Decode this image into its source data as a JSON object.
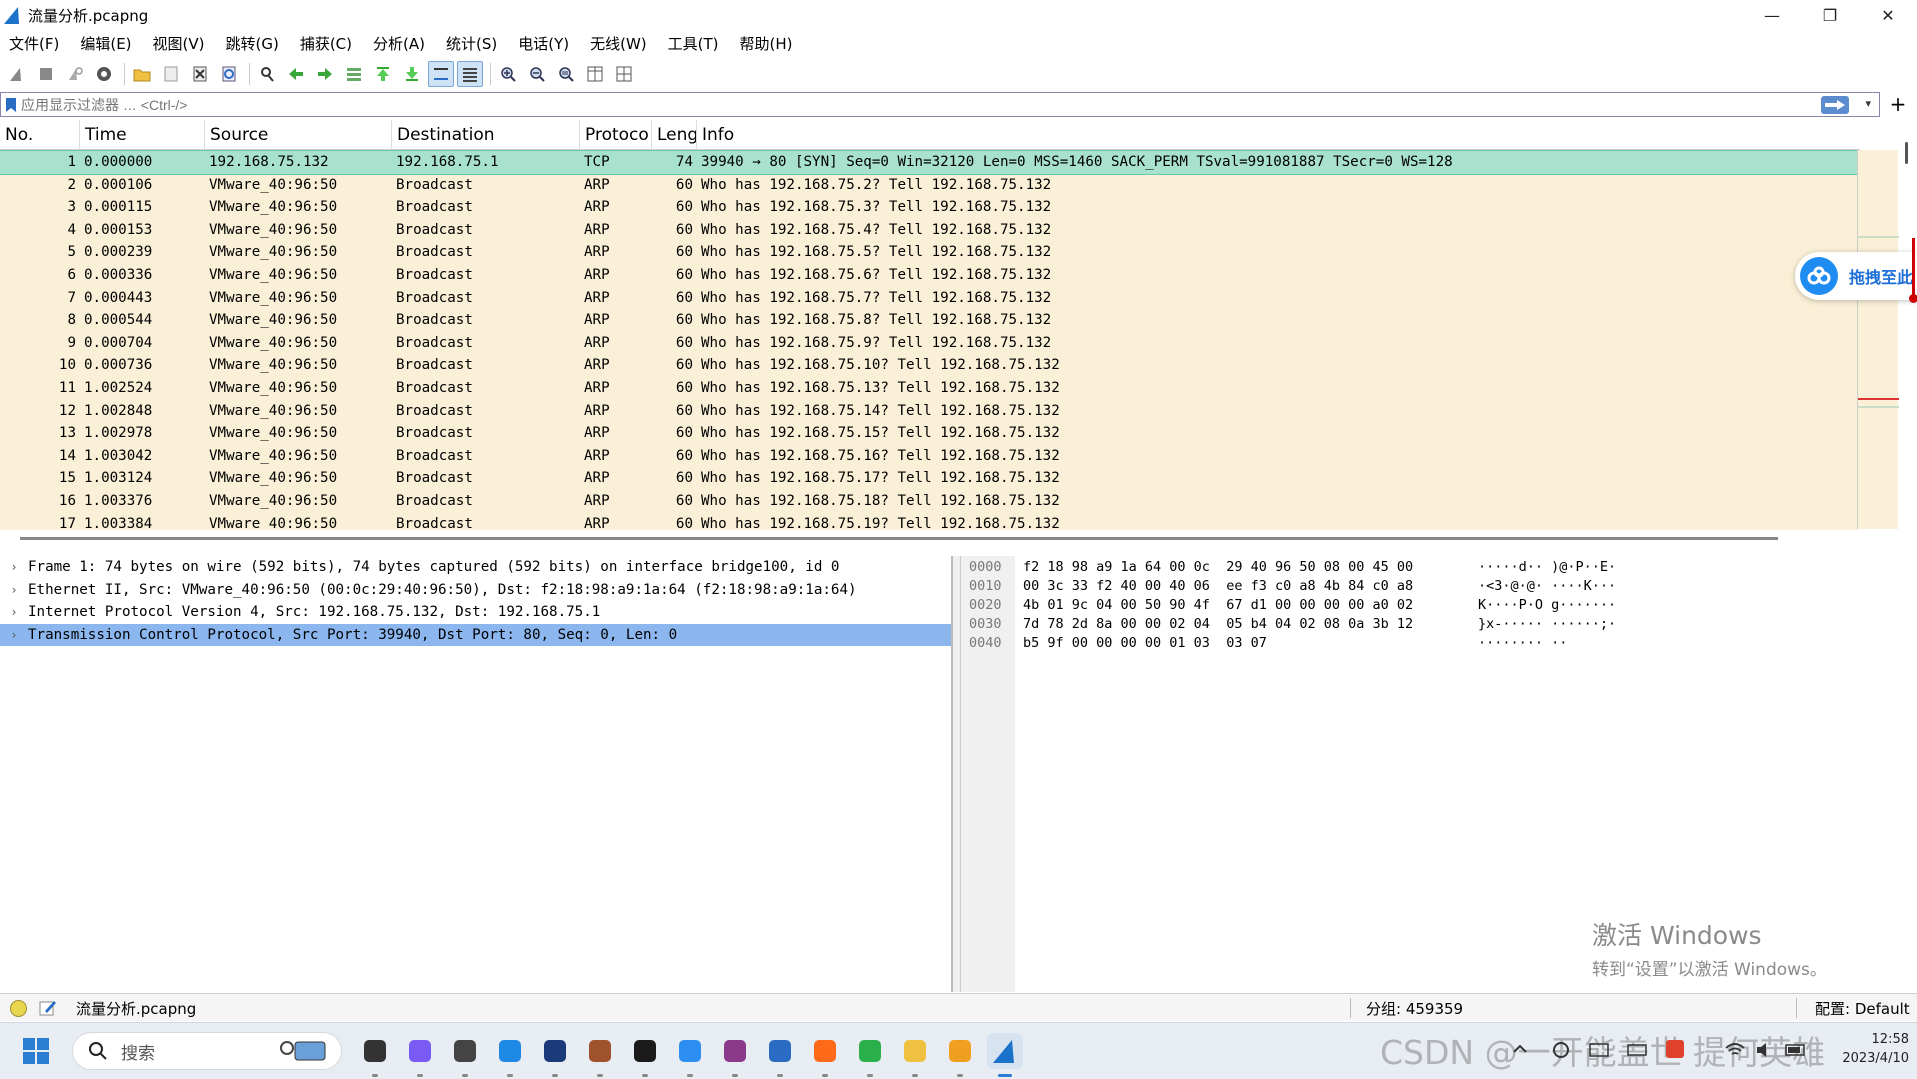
{
  "window": {
    "title": "流量分析.pcapng",
    "controls": {
      "minimize": "—",
      "restore": "❐",
      "close": "✕"
    }
  },
  "menu": [
    "文件(F)",
    "编辑(E)",
    "视图(V)",
    "跳转(G)",
    "捕获(C)",
    "分析(A)",
    "统计(S)",
    "电话(Y)",
    "无线(W)",
    "工具(T)",
    "帮助(H)"
  ],
  "toolbar": {
    "icons": [
      "shark-fin-start-icon",
      "stop-icon",
      "restart-icon",
      "capture-options-icon",
      "open-folder-icon",
      "save-icon",
      "close-file-icon",
      "reload-icon",
      "find-icon",
      "go-back-icon",
      "go-forward-icon",
      "go-to-packet-icon",
      "first-packet-icon",
      "last-packet-icon",
      "autoscroll-icon",
      "colorize-icon",
      "zoom-in-icon",
      "zoom-out-icon",
      "zoom-normal-icon",
      "resize-columns-icon",
      "layout-icon"
    ]
  },
  "filter": {
    "placeholder": "应用显示过滤器 … <Ctrl-/>",
    "add_label": "+"
  },
  "packet_list": {
    "columns": [
      "No.",
      "Time",
      "Source",
      "Destination",
      "Protoco",
      "Lengt",
      "Info"
    ],
    "rows": [
      {
        "no": "1",
        "time": "0.000000",
        "src": "192.168.75.132",
        "dst": "192.168.75.1",
        "proto": "TCP",
        "len": "74",
        "info": "39940 → 80 [SYN] Seq=0 Win=32120 Len=0 MSS=1460 SACK_PERM TSval=991081887 TSecr=0 WS=128"
      },
      {
        "no": "2",
        "time": "0.000106",
        "src": "VMware_40:96:50",
        "dst": "Broadcast",
        "proto": "ARP",
        "len": "60",
        "info": "Who has 192.168.75.2? Tell 192.168.75.132"
      },
      {
        "no": "3",
        "time": "0.000115",
        "src": "VMware_40:96:50",
        "dst": "Broadcast",
        "proto": "ARP",
        "len": "60",
        "info": "Who has 192.168.75.3? Tell 192.168.75.132"
      },
      {
        "no": "4",
        "time": "0.000153",
        "src": "VMware_40:96:50",
        "dst": "Broadcast",
        "proto": "ARP",
        "len": "60",
        "info": "Who has 192.168.75.4? Tell 192.168.75.132"
      },
      {
        "no": "5",
        "time": "0.000239",
        "src": "VMware_40:96:50",
        "dst": "Broadcast",
        "proto": "ARP",
        "len": "60",
        "info": "Who has 192.168.75.5? Tell 192.168.75.132"
      },
      {
        "no": "6",
        "time": "0.000336",
        "src": "VMware_40:96:50",
        "dst": "Broadcast",
        "proto": "ARP",
        "len": "60",
        "info": "Who has 192.168.75.6? Tell 192.168.75.132"
      },
      {
        "no": "7",
        "time": "0.000443",
        "src": "VMware_40:96:50",
        "dst": "Broadcast",
        "proto": "ARP",
        "len": "60",
        "info": "Who has 192.168.75.7? Tell 192.168.75.132"
      },
      {
        "no": "8",
        "time": "0.000544",
        "src": "VMware_40:96:50",
        "dst": "Broadcast",
        "proto": "ARP",
        "len": "60",
        "info": "Who has 192.168.75.8? Tell 192.168.75.132"
      },
      {
        "no": "9",
        "time": "0.000704",
        "src": "VMware_40:96:50",
        "dst": "Broadcast",
        "proto": "ARP",
        "len": "60",
        "info": "Who has 192.168.75.9? Tell 192.168.75.132"
      },
      {
        "no": "10",
        "time": "0.000736",
        "src": "VMware_40:96:50",
        "dst": "Broadcast",
        "proto": "ARP",
        "len": "60",
        "info": "Who has 192.168.75.10? Tell 192.168.75.132"
      },
      {
        "no": "11",
        "time": "1.002524",
        "src": "VMware_40:96:50",
        "dst": "Broadcast",
        "proto": "ARP",
        "len": "60",
        "info": "Who has 192.168.75.13? Tell 192.168.75.132"
      },
      {
        "no": "12",
        "time": "1.002848",
        "src": "VMware_40:96:50",
        "dst": "Broadcast",
        "proto": "ARP",
        "len": "60",
        "info": "Who has 192.168.75.14? Tell 192.168.75.132"
      },
      {
        "no": "13",
        "time": "1.002978",
        "src": "VMware_40:96:50",
        "dst": "Broadcast",
        "proto": "ARP",
        "len": "60",
        "info": "Who has 192.168.75.15? Tell 192.168.75.132"
      },
      {
        "no": "14",
        "time": "1.003042",
        "src": "VMware_40:96:50",
        "dst": "Broadcast",
        "proto": "ARP",
        "len": "60",
        "info": "Who has 192.168.75.16? Tell 192.168.75.132"
      },
      {
        "no": "15",
        "time": "1.003124",
        "src": "VMware_40:96:50",
        "dst": "Broadcast",
        "proto": "ARP",
        "len": "60",
        "info": "Who has 192.168.75.17? Tell 192.168.75.132"
      },
      {
        "no": "16",
        "time": "1.003376",
        "src": "VMware_40:96:50",
        "dst": "Broadcast",
        "proto": "ARP",
        "len": "60",
        "info": "Who has 192.168.75.18? Tell 192.168.75.132"
      },
      {
        "no": "17",
        "time": "1.003384",
        "src": "VMware_40:96:50",
        "dst": "Broadcast",
        "proto": "ARP",
        "len": "60",
        "info": "Who has 192.168.75.19? Tell 192.168.75.132"
      }
    ],
    "selected_row": 0,
    "colors": {
      "tcp_selected": "#a8e2cf",
      "arp": "#faf0d7"
    }
  },
  "cloud_widget": {
    "label": "拖拽至此"
  },
  "details": {
    "rows": [
      {
        "arrow": "›",
        "text": "Frame 1: 74 bytes on wire (592 bits), 74 bytes captured (592 bits) on interface bridge100, id 0"
      },
      {
        "arrow": "›",
        "text": "Ethernet II, Src: VMware_40:96:50 (00:0c:29:40:96:50), Dst: f2:18:98:a9:1a:64 (f2:18:98:a9:1a:64)"
      },
      {
        "arrow": "›",
        "text": "Internet Protocol Version 4, Src: 192.168.75.132, Dst: 192.168.75.1"
      },
      {
        "arrow": "›",
        "text": "Transmission Control Protocol, Src Port: 39940, Dst Port: 80, Seq: 0, Len: 0"
      }
    ],
    "selected_row": 3
  },
  "bytes": {
    "offsets": [
      "0000",
      "0010",
      "0020",
      "0030",
      "0040"
    ],
    "hex": [
      "f2 18 98 a9 1a 64 00 0c  29 40 96 50 08 00 45 00",
      "00 3c 33 f2 40 00 40 06  ee f3 c0 a8 4b 84 c0 a8",
      "4b 01 9c 04 00 50 90 4f  67 d1 00 00 00 00 a0 02",
      "7d 78 2d 8a 00 00 02 04  05 b4 04 02 08 0a 3b 12",
      "b5 9f 00 00 00 00 01 03  03 07"
    ],
    "ascii": [
      "·····d·· )@·P··E·",
      "·<3·@·@· ····K···",
      "K····P·O g·······",
      "}x-····· ······;·",
      "········ ··"
    ]
  },
  "watermark": {
    "title": "激活 Windows",
    "subtitle": "转到“设置”以激活 Windows。"
  },
  "status": {
    "file": "流量分析.pcapng",
    "packets": "分组: 459359",
    "profile": "配置: Default"
  },
  "taskbar": {
    "search_placeholder": "搜索",
    "apps": [
      "terminal-icon",
      "visual-studio-icon",
      "obs-icon",
      "app-store-icon",
      "dev-cpp-icon",
      "avatar-app-icon",
      "pycharm-icon",
      "baidu-netdisk-icon",
      "winrar-icon",
      "notepad-icon",
      "firefox-icon",
      "wechat-icon",
      "file-explorer-icon",
      "sunflower-icon",
      "wireshark-icon"
    ],
    "csdn_watermark": "CSDN @一开能盖世 提何英雄",
    "clock": {
      "time": "12:58",
      "date": "2023/4/10"
    }
  }
}
